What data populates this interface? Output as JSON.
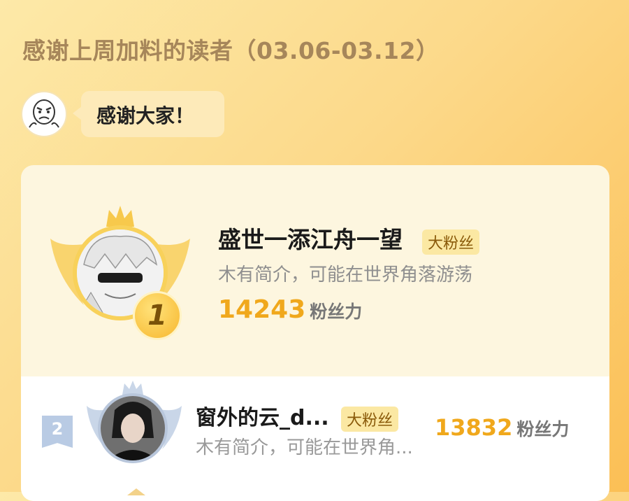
{
  "header": {
    "title": "感谢上周加料的读者（03.06-03.12）"
  },
  "message": {
    "text": "感谢大家！"
  },
  "ranking": [
    {
      "rank": "1",
      "name": "盛世一添江舟一望",
      "tag": "大粉丝",
      "description": "木有简介，可能在世界角落游荡",
      "score": "14243",
      "score_unit": "粉丝力"
    },
    {
      "rank": "2",
      "name": "窗外的云_d...",
      "tag": "大粉丝",
      "description": "木有简介，可能在世界角...",
      "score": "13832",
      "score_unit": "粉丝力"
    }
  ],
  "colors": {
    "accent": "#f0a81c",
    "gold": "#f8d15a",
    "silver": "#b9cbe4"
  }
}
